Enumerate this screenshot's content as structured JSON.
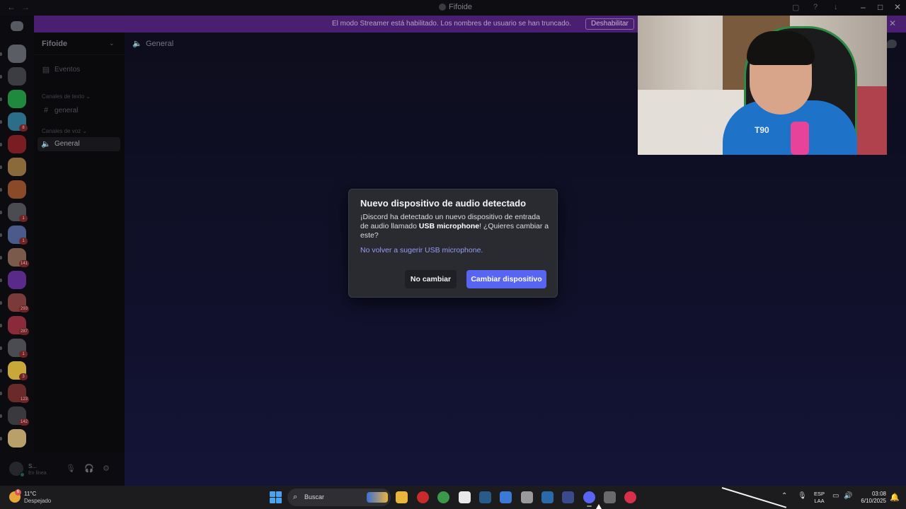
{
  "window": {
    "title": "Fifoide"
  },
  "banner": {
    "message": "El modo Streamer está habilitado. Los nombres de usuario se han truncado.",
    "button_label": "Deshabilitar"
  },
  "servers": [
    {
      "color": "#5a5d63",
      "badge": ""
    },
    {
      "color": "#3b3d42",
      "badge": ""
    },
    {
      "color": "#1f8a3e",
      "badge": ""
    },
    {
      "color": "#2c6e8a",
      "badge": "8"
    },
    {
      "color": "#7a1d22",
      "badge": ""
    },
    {
      "color": "#8a6a3a",
      "badge": ""
    },
    {
      "color": "#8a4a2a",
      "badge": ""
    },
    {
      "color": "#4a4c52",
      "badge": "1"
    },
    {
      "color": "#4a5a8a",
      "badge": "1"
    },
    {
      "color": "#7a5a4a",
      "badge": "141"
    },
    {
      "color": "#5a2a8a",
      "badge": ""
    },
    {
      "color": "#7a3a3a",
      "badge": "293"
    },
    {
      "color": "#8a2a3a",
      "badge": "287"
    },
    {
      "color": "#4a4c52",
      "badge": "1"
    },
    {
      "color": "#c9a83a",
      "badge": "3"
    },
    {
      "color": "#6a2a2a",
      "badge": "123"
    },
    {
      "color": "#3a3a3e",
      "badge": "142"
    },
    {
      "color": "#b9a06a",
      "badge": ""
    }
  ],
  "sidebar": {
    "server_name": "Fifoide",
    "events_label": "Eventos",
    "text_category": "Canales de texto",
    "text_channel": "general",
    "voice_category": "Canales de voz",
    "voice_channel": "General"
  },
  "user_panel": {
    "username": "S...",
    "status": "En línea"
  },
  "main": {
    "channel_name": "General"
  },
  "webcam": {
    "jersey_text": "T90"
  },
  "modal": {
    "title": "Nuevo dispositivo de audio detectado",
    "body_before": "¡Discord ha detectado un nuevo dispositivo de entrada de audio llamado ",
    "device_name": "USB microphone",
    "body_after": "! ¿Quieres cambiar a este?",
    "link_text": "No volver a sugerir USB microphone.",
    "cancel_label": "No cambiar",
    "confirm_label": "Cambiar dispositivo"
  },
  "taskbar": {
    "weather_badge": "6",
    "temperature": "11°C",
    "condition": "Despejado",
    "search_label": "Buscar",
    "lang_top": "ESP",
    "lang_bottom": "LAA",
    "time": "03:08",
    "date": "6/10/2025",
    "apps": [
      {
        "name": "file-explorer",
        "color": "#e9b53a"
      },
      {
        "name": "opera",
        "color": "#c92a2a"
      },
      {
        "name": "chrome",
        "color": "#3a9a4a"
      },
      {
        "name": "settings-cog",
        "color": "#e8e8e8"
      },
      {
        "name": "steam",
        "color": "#2a5a8a"
      },
      {
        "name": "app-blue",
        "color": "#3a7ad6"
      },
      {
        "name": "app-gear",
        "color": "#9a9a9a"
      },
      {
        "name": "app-store",
        "color": "#2a6aa8"
      },
      {
        "name": "app-audio",
        "color": "#3a4a8a"
      },
      {
        "name": "discord",
        "color": "#5865f2"
      },
      {
        "name": "app-settings",
        "color": "#6a6a6a"
      },
      {
        "name": "app-red",
        "color": "#d6304a"
      }
    ]
  }
}
